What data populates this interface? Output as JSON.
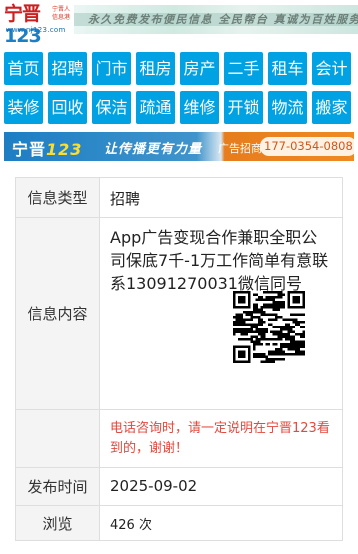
{
  "header": {
    "logo_main_a": "宁晋",
    "logo_main_b": "123",
    "logo_side": "宁晋人 \n信息港",
    "logo_url": "www.nj123.com",
    "slogan": "永久免费发布便民信息  全民帮台  真诚为百姓服务"
  },
  "nav": {
    "items": [
      {
        "label": "首页"
      },
      {
        "label": "招聘"
      },
      {
        "label": "门市"
      },
      {
        "label": "租房"
      },
      {
        "label": "房产"
      },
      {
        "label": "二手"
      },
      {
        "label": "租车"
      },
      {
        "label": "会计"
      },
      {
        "label": "装修"
      },
      {
        "label": "回收"
      },
      {
        "label": "保洁"
      },
      {
        "label": "疏通"
      },
      {
        "label": "维修"
      },
      {
        "label": "开锁"
      },
      {
        "label": "物流"
      },
      {
        "label": "搬家"
      }
    ]
  },
  "ad_banner": {
    "logo_a": "宁晋",
    "logo_b": "123",
    "slogan": "让传播更有力量",
    "contact_label": "广告招商",
    "phone": "177-0354-0808",
    "colors": {
      "left": "#1d7ec3",
      "right": "#ef8a22"
    }
  },
  "info": {
    "type_label": "信息类型",
    "type_value": "招聘",
    "content_label": "信息内容",
    "content_value": "App广告变现合作兼职全职公司保底7千-1万工作简单有意联系13091270031微信同号",
    "notice": "电话咨询时，请一定说明在宁晋123看到的，谢谢！",
    "date_label": "发布时间",
    "date_value": "2025-09-02",
    "views_label": "浏览",
    "views_value": "426 次"
  },
  "colors": {
    "nav": "#00a2e3",
    "notice": "#e6483d",
    "label_bg": "#f4f4f4"
  }
}
